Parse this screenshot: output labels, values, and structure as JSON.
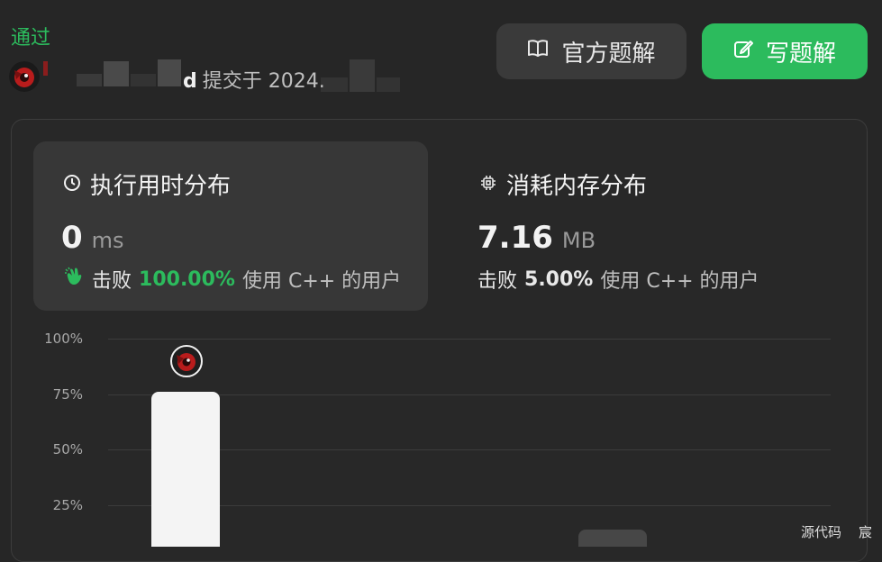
{
  "result": {
    "status": "通过"
  },
  "submission": {
    "username_tail": "d",
    "submitted_prefix": "提交于 2024."
  },
  "buttons": {
    "official_solution": "官方题解",
    "write_solution": "写题解"
  },
  "runtime": {
    "title": "执行用时分布",
    "value": "0",
    "unit": "ms",
    "beats_label": "击败",
    "beats_pct": "100.00%",
    "beats_suffix": "使用 C++ 的用户"
  },
  "memory": {
    "title": "消耗内存分布",
    "value": "7.16",
    "unit": "MB",
    "beats_label": "击败",
    "beats_pct": "5.00%",
    "beats_suffix": "使用 C++ 的用户"
  },
  "chart_data": {
    "type": "bar",
    "y_ticks": [
      "100%",
      "75%",
      "50%",
      "25%"
    ],
    "ylim": [
      0,
      100
    ],
    "values": [
      76,
      14
    ],
    "highlight_index": 0
  },
  "footer": {
    "source_code": "源代码",
    "trailing": "宸"
  },
  "colors": {
    "accent_green": "#2cbb5d",
    "background": "#262626",
    "card": "#373737"
  }
}
